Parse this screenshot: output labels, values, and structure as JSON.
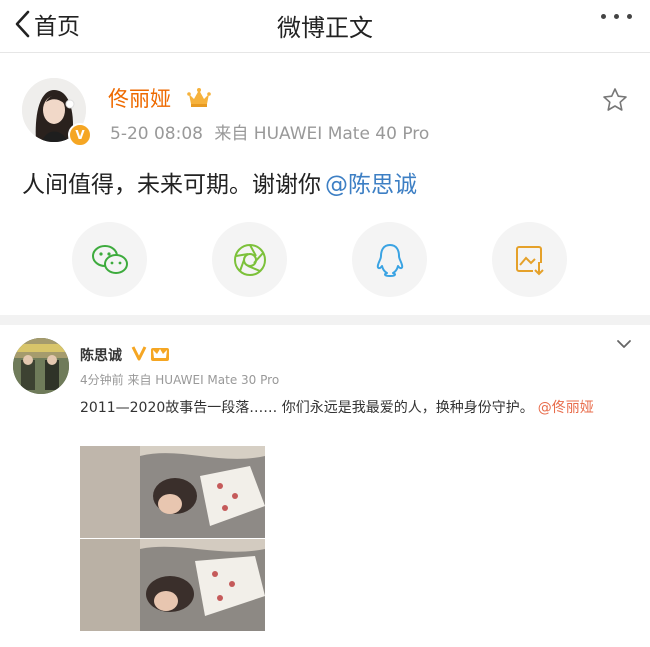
{
  "nav": {
    "back_label": "首页",
    "title": "微博正文"
  },
  "post1": {
    "author": "佟丽娅",
    "date": "5-20 08:08",
    "source": "来自 HUAWEI Mate 40 Pro",
    "text": "人间值得，未来可期。谢谢你",
    "mention": "@陈思诚",
    "share_buttons": [
      "wechat-icon",
      "moments-icon",
      "qq-icon",
      "save-image-icon"
    ]
  },
  "post2": {
    "author": "陈思诚",
    "meta": "4分钟前 来自 HUAWEI Mate 30 Pro",
    "text": "2011—2020故事告一段落…… 你们永远是我最爱的人，换种身份守护。",
    "mention": "@佟丽娅"
  },
  "colors": {
    "author_orange": "#ee6a00",
    "mention_blue": "#3d7fc4",
    "mention_red": "#e86c4b",
    "verified_gold": "#f5a623"
  }
}
